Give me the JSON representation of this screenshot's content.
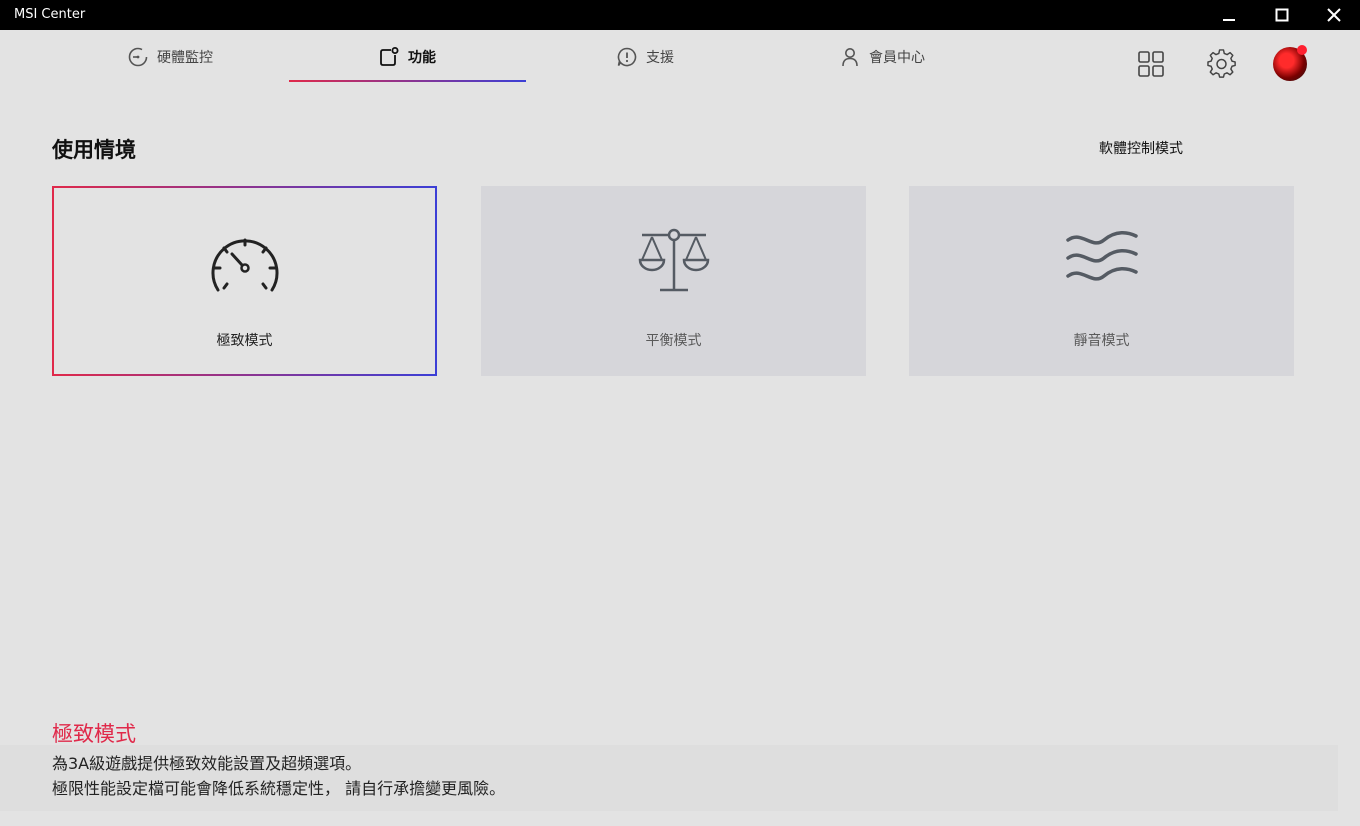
{
  "window": {
    "title": "MSI Center"
  },
  "nav": {
    "tabs": [
      {
        "label": "硬體監控",
        "icon": "gauge-icon"
      },
      {
        "label": "功能",
        "icon": "feature-icon",
        "active": true
      },
      {
        "label": "支援",
        "icon": "alert-icon"
      },
      {
        "label": "會員中心",
        "icon": "user-icon"
      }
    ],
    "right_icons": [
      "grid-icon",
      "gear-icon",
      "avatar"
    ]
  },
  "main": {
    "section_title": "使用情境",
    "control_mode": "軟體控制模式",
    "modes": [
      {
        "label": "極致模式",
        "icon": "speedometer-icon",
        "selected": true
      },
      {
        "label": "平衡模式",
        "icon": "balance-scale-icon",
        "selected": false
      },
      {
        "label": "靜音模式",
        "icon": "waves-icon",
        "selected": false
      }
    ]
  },
  "description": {
    "title": "極致模式",
    "line1": "為3A級遊戲提供極致效能設置及超頻選項。",
    "line2": "極限性能設定檔可能會降低系統穩定性， 請自行承擔變更風險。"
  },
  "colors": {
    "accent_start": "#e0294a",
    "accent_end": "#3b3fd6",
    "title_bar": "#000000"
  }
}
